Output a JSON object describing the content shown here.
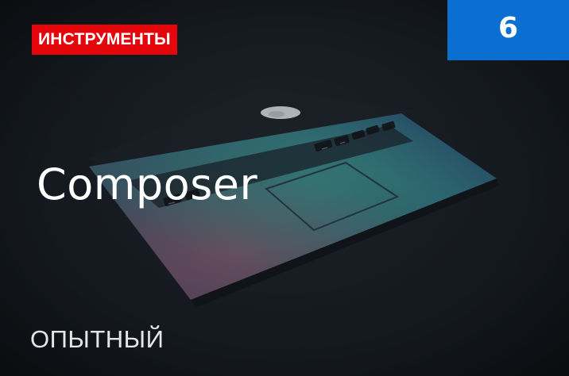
{
  "card": {
    "category": "ИНСТРУМЕНТЫ",
    "number": "6",
    "title": "Composer",
    "level": "ОПЫТНЫЙ"
  },
  "background": {
    "image": "laptop-dark-photo",
    "logo_icon": "apple-logo-icon"
  },
  "colors": {
    "category_badge": "#e5060b",
    "number_box": "#0a6fd0",
    "background": "#14181d",
    "text": "#ffffff"
  }
}
